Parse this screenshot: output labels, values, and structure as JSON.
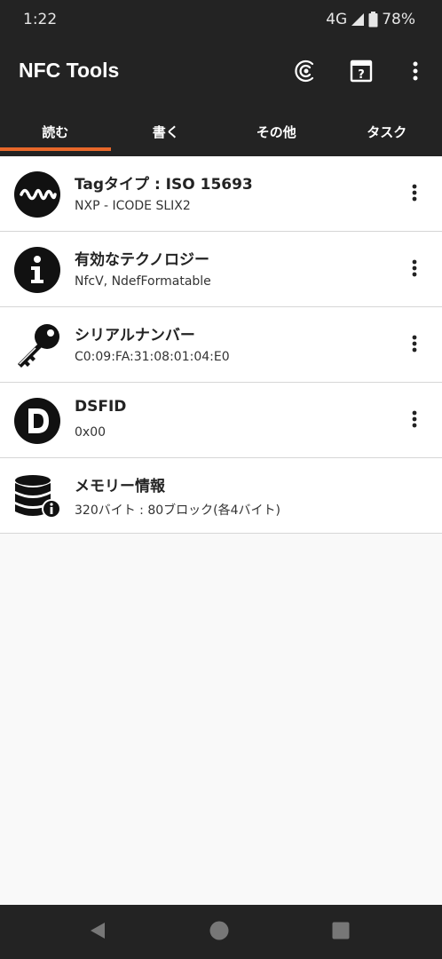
{
  "status": {
    "time": "1:22",
    "network": "4G",
    "battery": "78%"
  },
  "appbar": {
    "title": "NFC Tools",
    "actions": [
      "nfc-scan-icon",
      "help-icon",
      "more-vert-icon"
    ]
  },
  "tabs": [
    {
      "label": "読む",
      "active": true
    },
    {
      "label": "書く",
      "active": false
    },
    {
      "label": "その他",
      "active": false
    },
    {
      "label": "タスク",
      "active": false
    }
  ],
  "items": [
    {
      "icon": "waveform-icon",
      "title": "Tagタイプ : ISO 15693",
      "subtitle": "NXP - ICODE SLIX2",
      "has_menu": true
    },
    {
      "icon": "info-icon",
      "title": "有効なテクノロジー",
      "subtitle": "NfcV, NdefFormatable",
      "has_menu": true
    },
    {
      "icon": "key-icon",
      "title": "シリアルナンバー",
      "subtitle": "C0:09:FA:31:08:01:04:E0",
      "has_menu": true
    },
    {
      "icon": "letter-d-icon",
      "title": "DSFID",
      "subtitle": "0x00",
      "has_menu": true
    },
    {
      "icon": "database-info-icon",
      "title": "メモリー情報",
      "subtitle": "320バイト : 80ブロック(各4バイト)",
      "has_menu": false
    }
  ],
  "navbar": [
    "back-icon",
    "home-icon",
    "recents-icon"
  ],
  "colors": {
    "dark": "#232323",
    "accent": "#e8682a",
    "background": "#f9f9f9"
  }
}
